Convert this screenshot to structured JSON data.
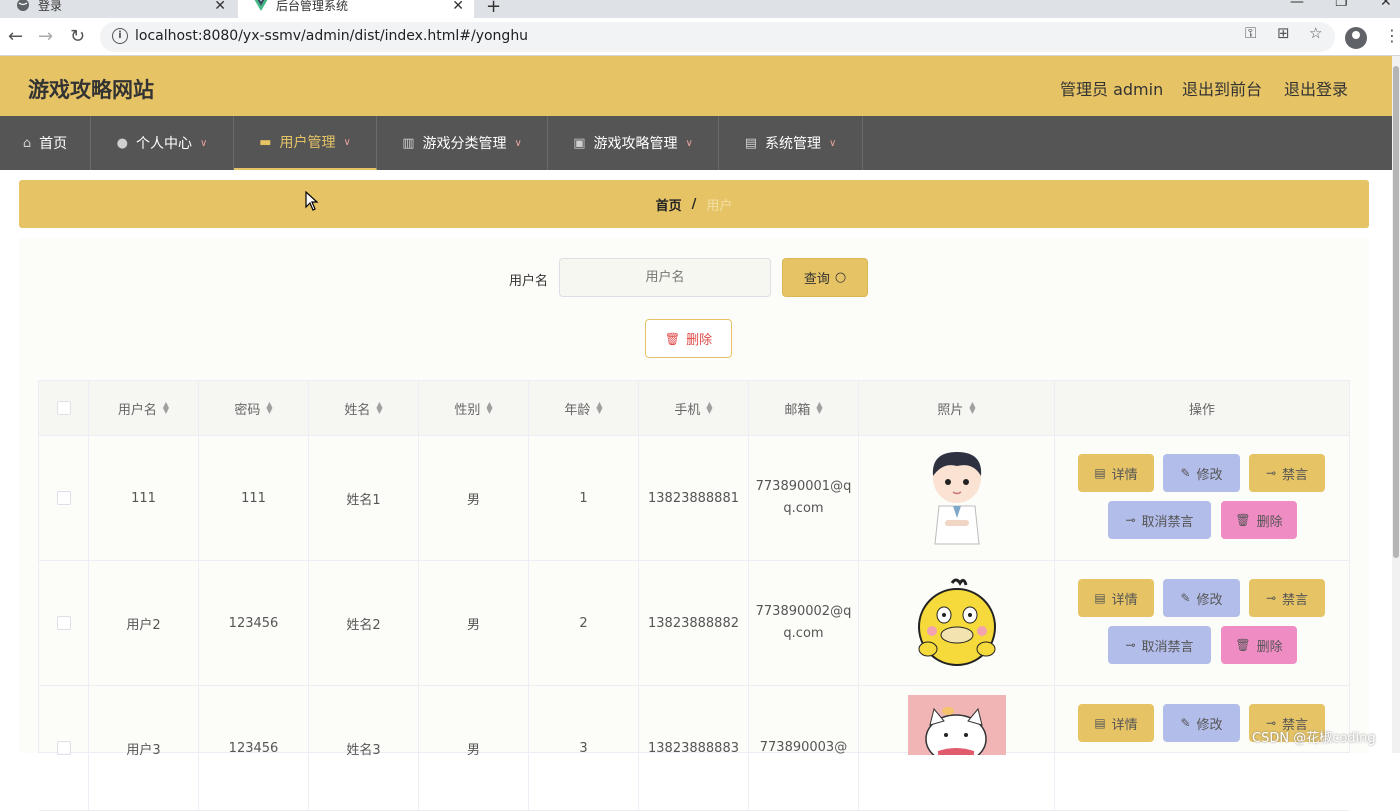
{
  "browser": {
    "tabs": [
      {
        "title": "登录",
        "active": false
      },
      {
        "title": "后台管理系统",
        "active": true
      }
    ],
    "url": "localhost:8080/yx-ssmv/admin/dist/index.html#/yonghu"
  },
  "header": {
    "site_title": "游戏攻略网站",
    "admin_label": "管理员 admin",
    "to_front": "退出到前台",
    "logout": "退出登录"
  },
  "nav": [
    {
      "label": "首页",
      "icon": "home-icon"
    },
    {
      "label": "个人中心",
      "icon": "user-icon"
    },
    {
      "label": "用户管理",
      "icon": "briefcase-icon",
      "active": true
    },
    {
      "label": "游戏分类管理",
      "icon": "books-icon"
    },
    {
      "label": "游戏攻略管理",
      "icon": "clipboard-icon"
    },
    {
      "label": "系统管理",
      "icon": "document-icon"
    }
  ],
  "breadcrumb": {
    "home": "首页",
    "separator": "/",
    "current": "用户"
  },
  "search": {
    "label": "用户名",
    "placeholder": "用户名",
    "button": "查询"
  },
  "bulk_delete": "删除",
  "table": {
    "columns": [
      "用户名",
      "密码",
      "姓名",
      "性别",
      "年龄",
      "手机",
      "邮箱",
      "照片",
      "操作"
    ],
    "rows": [
      {
        "username": "111",
        "password": "111",
        "name": "姓名1",
        "gender": "男",
        "age": "1",
        "phone": "13823888881",
        "email": "773890001@qq.com",
        "photo": "boy-avatar"
      },
      {
        "username": "用户2",
        "password": "123456",
        "name": "姓名2",
        "gender": "男",
        "age": "2",
        "phone": "13823888882",
        "email": "773890002@qq.com",
        "photo": "yellow-duck"
      },
      {
        "username": "用户3",
        "password": "123456",
        "name": "姓名3",
        "gender": "男",
        "age": "3",
        "phone": "13823888883",
        "email": "773890003@",
        "photo": "white-cat"
      }
    ],
    "actions": {
      "detail": "详情",
      "edit": "修改",
      "ban": "禁言",
      "unban": "取消禁言",
      "delete": "删除"
    }
  },
  "watermark": "CSDN @花椒coding",
  "colors": {
    "theme": "#e6c466",
    "nav_bg": "#555555",
    "edit_btn": "#b3bdea",
    "delete_btn": "#f08cc4"
  }
}
